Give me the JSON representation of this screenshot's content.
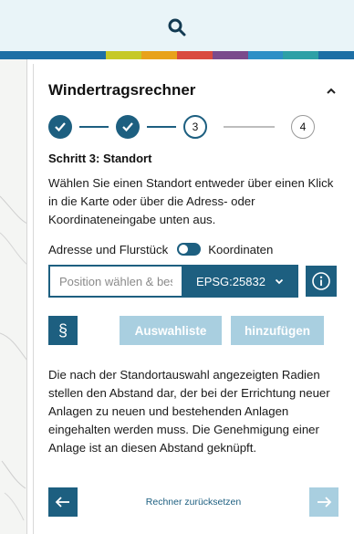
{
  "header": {
    "search_icon": "search-icon",
    "band_colors": [
      "#1d6fa5",
      "#1d6fa5",
      "#1d6fa5",
      "#c6c927",
      "#e8a21b",
      "#d94a3f",
      "#7a4a8c",
      "#2e8fc6",
      "#2ea0a6",
      "#1d6fa5"
    ]
  },
  "panel": {
    "title": "Windertragsrechner",
    "collapse_icon": "chevron-up-icon",
    "steps": [
      {
        "state": "done",
        "label": ""
      },
      {
        "state": "done",
        "label": ""
      },
      {
        "state": "current",
        "label": "3"
      },
      {
        "state": "future",
        "label": "4"
      }
    ],
    "step_heading": "Schritt 3: Standort",
    "step_description": "Wählen Sie einen Standort entweder über einen Klick in die Karte oder über die Adress- oder Koordinateneingabe unten aus.",
    "toggle": {
      "left_label": "Adresse und Flurstück",
      "right_label": "Koordinaten",
      "state": "koordinaten"
    },
    "position_input": {
      "value": "",
      "placeholder": "Position wählen & best"
    },
    "crs_select": {
      "selected": "EPSG:25832"
    },
    "info_icon": "info-icon",
    "law_button": {
      "label": "§"
    },
    "selection_list_button": "Auswahliste",
    "add_button": "hinzufügen",
    "info_text": "Die nach der Standortauswahl angezeigten Radien stellen den Abstand dar, der bei der Errichtung neuer Anlagen zu neuen und bestehenden Anlagen eingehalten werden muss. Die Genehmigung einer Anlage ist an diesen Abstand geknüpft.",
    "reset_link": "Rechner zurücksetzen",
    "prev_icon": "arrow-left-icon",
    "next_icon": "arrow-right-icon"
  },
  "colors": {
    "primary": "#1d5f80",
    "disabled": "#a9cfe0",
    "topbar_bg": "#e9f4f8"
  }
}
